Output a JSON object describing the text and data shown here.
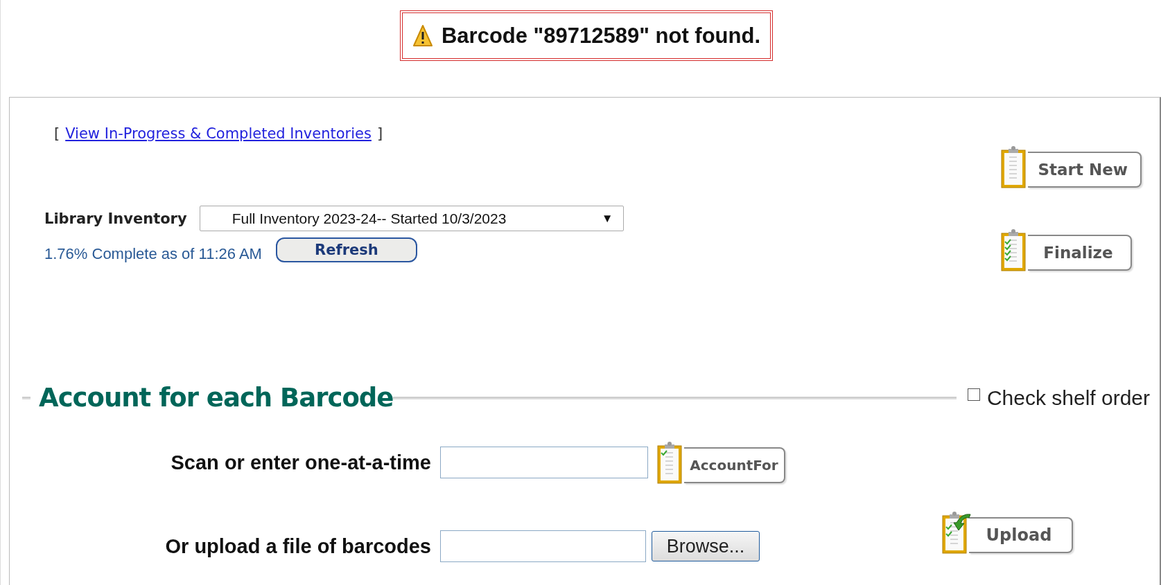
{
  "alert": {
    "kind": "warning",
    "message": "Barcode \"89712589\" not found."
  },
  "inventories_link": {
    "open": "[",
    "label": "View In-Progress & Completed Inventories",
    "close": "]"
  },
  "inventory": {
    "label": "Library Inventory",
    "value": "Full Inventory 2023-24-- Started 10/3/2023",
    "arrow": "▼",
    "progress": "1.76% Complete as of 11:26 AM",
    "refresh": "Refresh"
  },
  "side_buttons": [
    {
      "kind": "blank",
      "label": "Start New"
    },
    {
      "kind": "checks",
      "label": "Finalize"
    }
  ],
  "account_section": {
    "title": "Account for each Barcode",
    "check_shelf_order": {
      "label": "Check shelf order",
      "checked": false
    },
    "scan": {
      "label": "Scan or enter one-at-a-time",
      "button": {
        "kind": "check",
        "label": "AccountFor"
      }
    },
    "upload": {
      "label": "Or upload a file of barcodes",
      "browse": "Browse...",
      "button": {
        "kind": "upload",
        "label": "Upload"
      }
    }
  }
}
